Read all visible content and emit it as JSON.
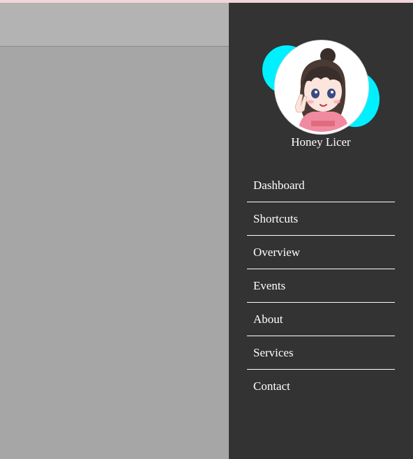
{
  "profile": {
    "name": "Honey Licer",
    "avatar_icon": "chibi-girl-avatar-icon"
  },
  "nav": {
    "items": [
      {
        "label": "Dashboard"
      },
      {
        "label": "Shortcuts"
      },
      {
        "label": "Overview"
      },
      {
        "label": "Events"
      },
      {
        "label": "About"
      },
      {
        "label": "Services"
      },
      {
        "label": "Contact"
      }
    ]
  },
  "colors": {
    "sidebar_bg": "#333333",
    "main_bg": "#a6a6a6",
    "header_bg": "#b3b3b3",
    "accent_cyan": "#00f0ff",
    "top_strip": "#f3d6da"
  }
}
